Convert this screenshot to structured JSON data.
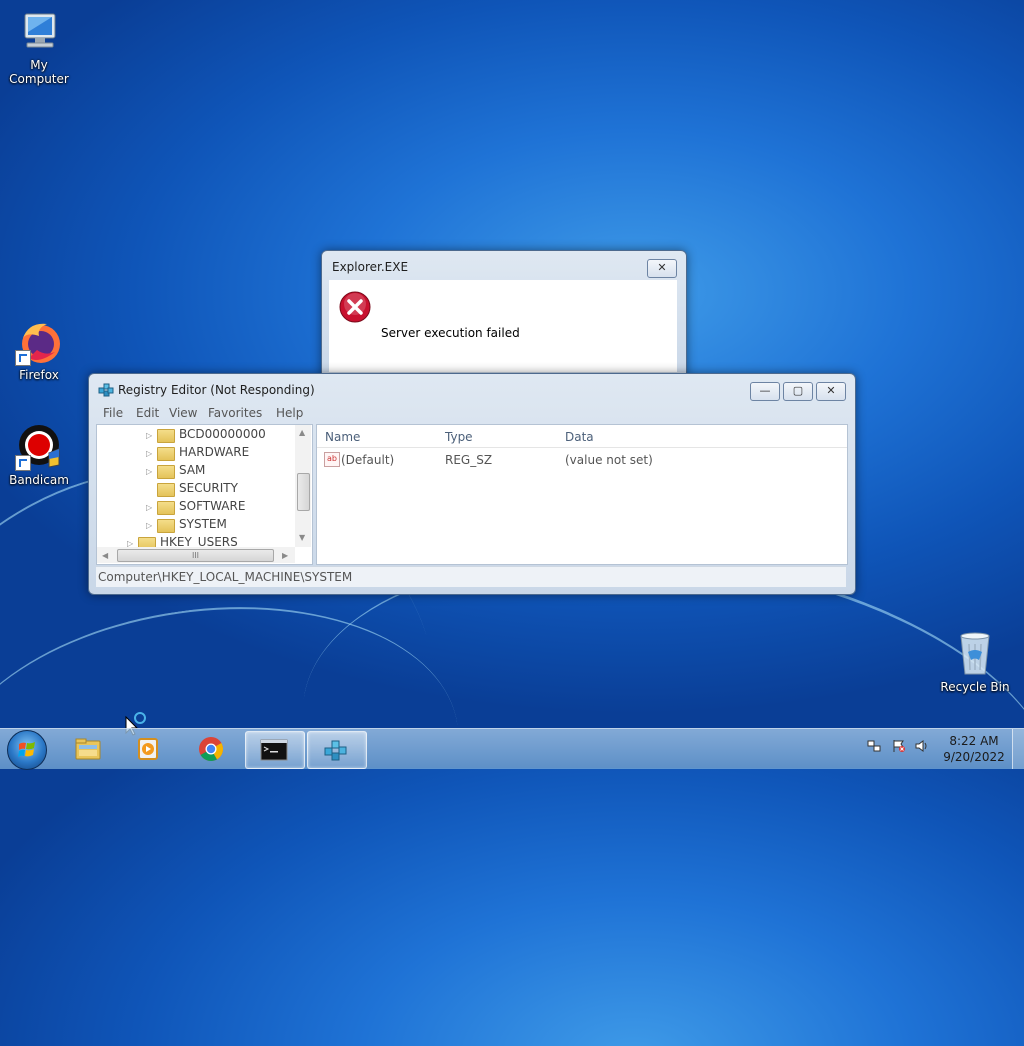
{
  "desktop": {
    "icons": {
      "my_computer": "My Computer",
      "firefox": "Firefox",
      "bandicam": "Bandicam",
      "recycle_bin": "Recycle Bin"
    }
  },
  "error_dialog": {
    "title": "Explorer.EXE",
    "message": "Server execution failed",
    "close_symbol": "✕",
    "icon": "error-icon"
  },
  "regedit": {
    "title": "Registry Editor (Not Responding)",
    "caption_buttons": {
      "minimize": "—",
      "maximize": "▢",
      "close": "✕"
    },
    "menu": [
      "File",
      "Edit",
      "View",
      "Favorites",
      "Help"
    ],
    "tree": [
      {
        "label": "BCD00000000",
        "expandable": true
      },
      {
        "label": "HARDWARE",
        "expandable": true
      },
      {
        "label": "SAM",
        "expandable": true
      },
      {
        "label": "SECURITY",
        "expandable": false
      },
      {
        "label": "SOFTWARE",
        "expandable": true
      },
      {
        "label": "SYSTEM",
        "expandable": true
      },
      {
        "label": "HKEY_USERS",
        "expandable": true
      }
    ],
    "hscroll_grip": "III",
    "columns": [
      "Name",
      "Type",
      "Data"
    ],
    "values": [
      {
        "name": "(Default)",
        "type": "REG_SZ",
        "data": "(value not set)",
        "icon": "string-value-icon"
      }
    ],
    "status_path": "Computer\\HKEY_LOCAL_MACHINE\\SYSTEM"
  },
  "taskbar": {
    "items": [
      "start-orb",
      "explorer",
      "media-player",
      "chrome",
      "command-prompt",
      "registry-editor"
    ],
    "active_items": [
      "command-prompt",
      "registry-editor"
    ],
    "clock_time": "8:22 AM",
    "clock_date": "9/20/2022",
    "tray_icons": [
      "network-icon",
      "action-center-flag-icon",
      "volume-icon"
    ]
  },
  "colors": {
    "desktop_blue": "#1f73d6",
    "error_red": "#c8102e",
    "window_frame": "#c9d7e8"
  }
}
